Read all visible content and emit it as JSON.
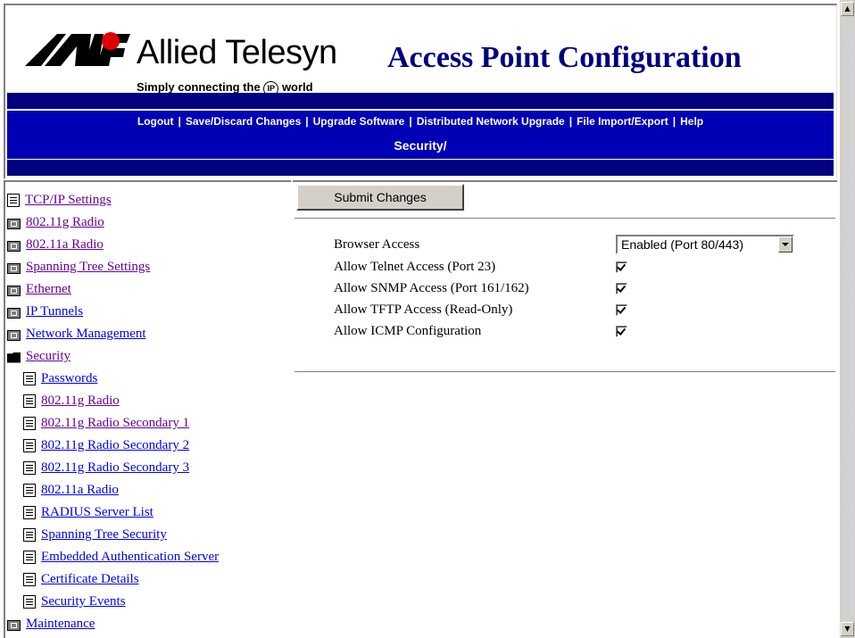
{
  "header": {
    "logo_name": "Allied Telesyn",
    "logo_tagline_pre": "Simply connecting the",
    "logo_tagline_ip": "IP",
    "logo_tagline_post": "world",
    "title": "Access Point Configuration"
  },
  "toolbar": {
    "items": [
      "Logout",
      "Save/Discard Changes",
      "Upgrade Software",
      "Distributed Network Upgrade",
      "File Import/Export",
      "Help"
    ],
    "separator": "|"
  },
  "section": "Security/",
  "nav": {
    "items": [
      {
        "label": "TCP/IP Settings",
        "icon": "document-icon"
      },
      {
        "label": "802.11g Radio",
        "icon": "folder-icon"
      },
      {
        "label": "802.11a Radio",
        "icon": "folder-icon"
      },
      {
        "label": "Spanning Tree Settings",
        "icon": "folder-icon"
      },
      {
        "label": "Ethernet",
        "icon": "folder-icon"
      },
      {
        "label": "IP Tunnels",
        "icon": "folder-icon"
      },
      {
        "label": "Network Management",
        "icon": "folder-icon"
      },
      {
        "label": "Security",
        "icon": "folder-open-icon"
      },
      {
        "label": "Passwords",
        "icon": "document-icon"
      },
      {
        "label": "802.11g Radio",
        "icon": "document-icon"
      },
      {
        "label": "802.11g Radio Secondary 1",
        "icon": "document-icon"
      },
      {
        "label": "802.11g Radio Secondary 2",
        "icon": "document-icon"
      },
      {
        "label": "802.11g Radio Secondary 3",
        "icon": "document-icon"
      },
      {
        "label": "802.11a Radio",
        "icon": "document-icon"
      },
      {
        "label": "RADIUS Server List",
        "icon": "document-icon"
      },
      {
        "label": "Spanning Tree Security",
        "icon": "document-icon"
      },
      {
        "label": "Embedded Authentication Server",
        "icon": "document-icon"
      },
      {
        "label": "Certificate Details",
        "icon": "document-icon"
      },
      {
        "label": "Security Events",
        "icon": "document-icon"
      },
      {
        "label": "Maintenance",
        "icon": "folder-icon"
      }
    ]
  },
  "content": {
    "submit_label": "Submit Changes",
    "browser_access_label": "Browser Access",
    "browser_access_value": "Enabled (Port 80/443)",
    "telnet_label": "Allow Telnet Access (Port 23)",
    "telnet_checked": true,
    "snmp_label": "Allow SNMP Access (Port 161/162)",
    "snmp_checked": true,
    "tftp_label": "Allow TFTP Access (Read-Only)",
    "tftp_checked": true,
    "icmp_label": "Allow ICMP Configuration",
    "icmp_checked": true
  },
  "colors": {
    "header_blue": "#0000b4",
    "dark_blue": "#000080",
    "link": "#0000ee",
    "visited": "#660099"
  }
}
